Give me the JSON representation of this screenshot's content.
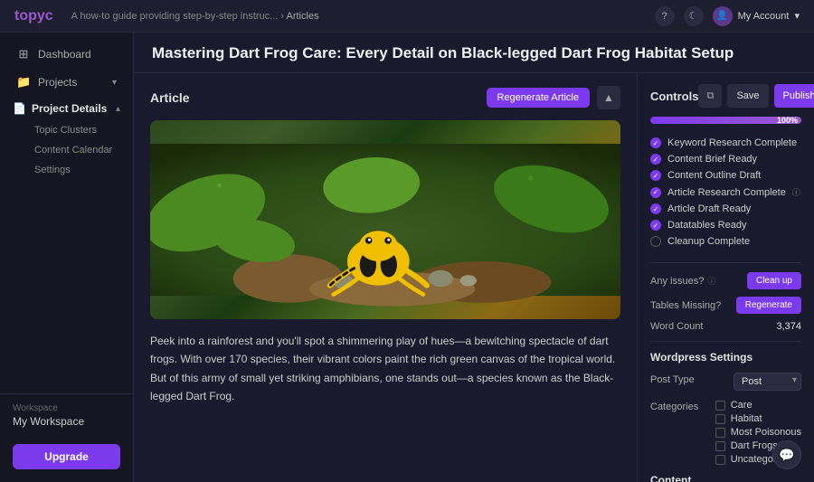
{
  "topbar": {
    "logo": "topyc",
    "breadcrumb_text": "A how-to guide providing step-by-step instruc...",
    "breadcrumb_separator": "›",
    "breadcrumb_link": "Articles",
    "account_label": "My Account",
    "account_chevron": "▾",
    "help_icon": "?",
    "moon_icon": "☾"
  },
  "page": {
    "title": "Mastering Dart Frog Care: Every Detail on Black-legged Dart Frog Habitat Setup"
  },
  "article": {
    "label": "Article",
    "regenerate_button": "Regenerate Article",
    "collapse_button": "▲",
    "body_text": "Peek into a rainforest and you'll spot a shimmering play of hues—a bewitching spectacle of dart frogs. With over 170 species, their vibrant colors paint the rich green canvas of the tropical world. But of this army of small yet striking amphibians, one stands out—a species known as the Black-legged Dart Frog."
  },
  "controls": {
    "title": "Controls",
    "save_label": "Save",
    "publish_label": "Publish",
    "progress_percent": "100%",
    "progress_value": 100,
    "checklist": [
      {
        "label": "Keyword Research Complete",
        "done": true
      },
      {
        "label": "Content Brief Ready",
        "done": true
      },
      {
        "label": "Content Outline Draft",
        "done": true
      },
      {
        "label": "Article Research Complete",
        "done": true,
        "info": true
      },
      {
        "label": "Article Draft Ready",
        "done": true
      },
      {
        "label": "Datatables Ready",
        "done": true
      },
      {
        "label": "Cleanup Complete",
        "done": false
      }
    ],
    "any_issues_label": "Any issues?",
    "any_issues_info": "?",
    "clean_up_button": "Clean up",
    "tables_missing_label": "Tables Missing?",
    "regenerate_button": "Regenerate",
    "word_count_label": "Word Count",
    "word_count_value": "3,374"
  },
  "wordpress": {
    "section_title": "Wordpress Settings",
    "post_type_label": "Post Type",
    "post_type_value": "Post",
    "categories_label": "Categories",
    "categories": [
      {
        "label": "Care",
        "checked": false
      },
      {
        "label": "Habitat",
        "checked": false
      },
      {
        "label": "Most Poisonous",
        "checked": false
      },
      {
        "label": "Dart Frogs",
        "checked": false
      },
      {
        "label": "Uncategorized",
        "checked": false
      }
    ],
    "content_section_title": "Content"
  },
  "sidebar": {
    "nav_items": [
      {
        "icon": "⊞",
        "label": "Dashboard",
        "active": false
      },
      {
        "icon": "📁",
        "label": "Projects",
        "active": false,
        "has_chevron": true
      }
    ],
    "project_details_label": "Project Details",
    "project_details_active": true,
    "sub_items": [
      "Topic Clusters",
      "Content Calendar",
      "Settings"
    ],
    "workspace_label": "Workspace",
    "workspace_name": "My Workspace",
    "upgrade_button": "Upgrade"
  }
}
